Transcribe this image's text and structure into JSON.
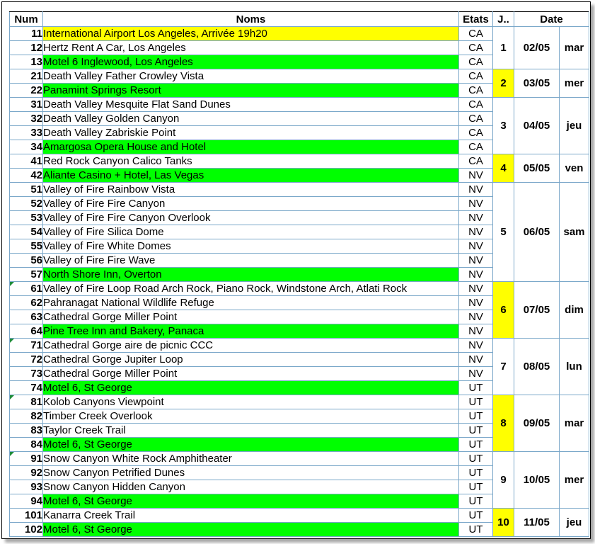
{
  "headers": {
    "num": "Num",
    "noms": "Noms",
    "etats": "Etats",
    "jour": "J..",
    "date": "Date"
  },
  "rows": [
    {
      "num": "11",
      "nom": "International Airport Los Angeles, Arrivée 19h20",
      "etat": "CA",
      "fill": "yellow"
    },
    {
      "num": "12",
      "nom": "Hertz Rent A Car, Los Angeles",
      "etat": "CA",
      "fill": ""
    },
    {
      "num": "13",
      "nom": "Motel 6 Inglewood, Los Angeles",
      "etat": "CA",
      "fill": "green"
    },
    {
      "num": "21",
      "nom": "Death Valley Father Crowley Vista",
      "etat": "CA",
      "fill": ""
    },
    {
      "num": "22",
      "nom": "Panamint Springs Resort",
      "etat": "CA",
      "fill": "green"
    },
    {
      "num": "31",
      "nom": "Death Valley Mesquite Flat Sand Dunes",
      "etat": "CA",
      "fill": ""
    },
    {
      "num": "32",
      "nom": "Death Valley Golden Canyon",
      "etat": "CA",
      "fill": ""
    },
    {
      "num": "33",
      "nom": "Death Valley Zabriskie Point",
      "etat": "CA",
      "fill": ""
    },
    {
      "num": "34",
      "nom": "Amargosa Opera House and Hotel",
      "etat": "CA",
      "fill": "green"
    },
    {
      "num": "41",
      "nom": "Red Rock Canyon Calico Tanks",
      "etat": "CA",
      "fill": ""
    },
    {
      "num": "42",
      "nom": "Aliante Casino + Hotel, Las Vegas",
      "etat": "NV",
      "fill": "green"
    },
    {
      "num": "51",
      "nom": "Valley of Fire Rainbow Vista",
      "etat": "NV",
      "fill": ""
    },
    {
      "num": "52",
      "nom": "Valley of Fire Fire Canyon",
      "etat": "NV",
      "fill": ""
    },
    {
      "num": "53",
      "nom": "Valley of Fire Fire Canyon Overlook",
      "etat": "NV",
      "fill": ""
    },
    {
      "num": "54",
      "nom": "Valley of Fire Silica Dome",
      "etat": "NV",
      "fill": ""
    },
    {
      "num": "55",
      "nom": "Valley of Fire White Domes",
      "etat": "NV",
      "fill": ""
    },
    {
      "num": "56",
      "nom": "Valley of Fire Fire Wave",
      "etat": "NV",
      "fill": ""
    },
    {
      "num": "57",
      "nom": "North Shore Inn, Overton",
      "etat": "NV",
      "fill": "green"
    },
    {
      "num": "61",
      "nom": "Valley of Fire Loop Road Arch Rock, Piano Rock, Windstone Arch, Atlati Rock",
      "etat": "NV",
      "fill": "",
      "marker": true
    },
    {
      "num": "62",
      "nom": "Pahranagat National Wildlife Refuge",
      "etat": "NV",
      "fill": ""
    },
    {
      "num": "63",
      "nom": "Cathedral Gorge Miller Point",
      "etat": "NV",
      "fill": ""
    },
    {
      "num": "64",
      "nom": "Pine Tree Inn and Bakery, Panaca",
      "etat": "NV",
      "fill": "green"
    },
    {
      "num": "71",
      "nom": "Cathedral Gorge aire de picnic CCC",
      "etat": "NV",
      "fill": "",
      "marker": true
    },
    {
      "num": "72",
      "nom": "Cathedral Gorge Jupiter Loop",
      "etat": "NV",
      "fill": ""
    },
    {
      "num": "73",
      "nom": "Cathedral Gorge Miller Point",
      "etat": "NV",
      "fill": ""
    },
    {
      "num": "74",
      "nom": "Motel 6, St George",
      "etat": "UT",
      "fill": "green"
    },
    {
      "num": "81",
      "nom": "Kolob Canyons Viewpoint",
      "etat": "UT",
      "fill": "",
      "marker": true
    },
    {
      "num": "82",
      "nom": "Timber Creek Overlook",
      "etat": "UT",
      "fill": ""
    },
    {
      "num": "83",
      "nom": "Taylor Creek Trail",
      "etat": "UT",
      "fill": ""
    },
    {
      "num": "84",
      "nom": "Motel 6, St George",
      "etat": "UT",
      "fill": "green"
    },
    {
      "num": "91",
      "nom": "Snow Canyon White Rock Amphitheater",
      "etat": "UT",
      "fill": "",
      "marker": true
    },
    {
      "num": "92",
      "nom": "Snow Canyon Petrified Dunes",
      "etat": "UT",
      "fill": ""
    },
    {
      "num": "93",
      "nom": "Snow Canyon Hidden Canyon",
      "etat": "UT",
      "fill": ""
    },
    {
      "num": "94",
      "nom": "Motel 6, St George",
      "etat": "UT",
      "fill": "green"
    },
    {
      "num": "101",
      "nom": "Kanarra Creek Trail",
      "etat": "UT",
      "fill": ""
    },
    {
      "num": "102",
      "nom": "Motel 6, St George",
      "etat": "UT",
      "fill": "green"
    }
  ],
  "days": [
    {
      "jour": "1",
      "date": "02/05",
      "dow": "mar",
      "highlight": false,
      "count": 3
    },
    {
      "jour": "2",
      "date": "03/05",
      "dow": "mer",
      "highlight": true,
      "count": 2
    },
    {
      "jour": "3",
      "date": "04/05",
      "dow": "jeu",
      "highlight": false,
      "count": 4
    },
    {
      "jour": "4",
      "date": "05/05",
      "dow": "ven",
      "highlight": true,
      "count": 2
    },
    {
      "jour": "5",
      "date": "06/05",
      "dow": "sam",
      "highlight": false,
      "count": 7
    },
    {
      "jour": "6",
      "date": "07/05",
      "dow": "dim",
      "highlight": true,
      "count": 4
    },
    {
      "jour": "7",
      "date": "08/05",
      "dow": "lun",
      "highlight": false,
      "count": 4
    },
    {
      "jour": "8",
      "date": "09/05",
      "dow": "mar",
      "highlight": true,
      "count": 4
    },
    {
      "jour": "9",
      "date": "10/05",
      "dow": "mer",
      "highlight": false,
      "count": 4
    },
    {
      "jour": "10",
      "date": "11/05",
      "dow": "jeu",
      "highlight": true,
      "count": 2
    }
  ],
  "colors": {
    "green": "#00ff00",
    "yellow": "#ffff00",
    "grid": "#7aa7c9"
  }
}
